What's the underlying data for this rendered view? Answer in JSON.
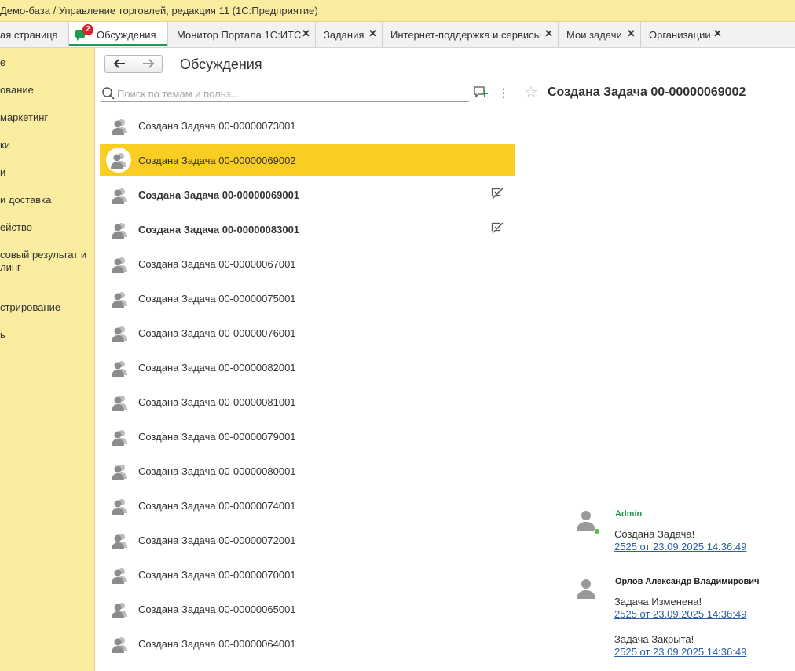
{
  "window": {
    "title": "Демо-база / Управление торговлей, редакция 11  (1С:Предприятие)"
  },
  "tabs": [
    {
      "label": "ая страница"
    },
    {
      "label": "Обсуждения",
      "badge": "2",
      "active": true
    },
    {
      "label": "Монитор Портала 1С:ИТС",
      "close": "✕"
    },
    {
      "label": "Задания",
      "close": "✕"
    },
    {
      "label": "Интернет-поддержка и сервисы",
      "close": "✕"
    },
    {
      "label": "Мои задачи",
      "close": "✕"
    },
    {
      "label": "Организации",
      "close": "✕"
    }
  ],
  "sidebar": {
    "items": [
      {
        "label": "е"
      },
      {
        "label": "ование"
      },
      {
        "label": "маркетинг"
      },
      {
        "label": "ки"
      },
      {
        "label": "и"
      },
      {
        "label": "и доставка"
      },
      {
        "label": "ейство"
      },
      {
        "label": "совый результат и",
        "label2": "линг"
      },
      {
        "label": "стрирование"
      },
      {
        "label": "ь"
      }
    ]
  },
  "header": {
    "title": "Обсуждения",
    "back_icon": "arrow-left-icon",
    "forward_icon": "arrow-right-icon"
  },
  "search": {
    "placeholder": "Поиск по темам и польз..."
  },
  "discussions": [
    {
      "label": "Создана Задача 00-00000073001"
    },
    {
      "label": "Создана Задача 00-00000069002",
      "selected": true
    },
    {
      "label": "Создана Задача 00-00000069001",
      "unread": true
    },
    {
      "label": "Создана Задача 00-00000083001",
      "unread": true
    },
    {
      "label": "Создана Задача 00-00000067001"
    },
    {
      "label": "Создана Задача 00-00000075001"
    },
    {
      "label": "Создана Задача 00-00000076001"
    },
    {
      "label": "Создана Задача 00-00000082001"
    },
    {
      "label": "Создана Задача 00-00000081001"
    },
    {
      "label": "Создана Задача 00-00000079001"
    },
    {
      "label": "Создана Задача 00-00000080001"
    },
    {
      "label": "Создана Задача 00-00000074001"
    },
    {
      "label": "Создана Задача 00-00000072001"
    },
    {
      "label": "Создана Задача 00-00000070001"
    },
    {
      "label": "Создана Задача 00-00000065001"
    },
    {
      "label": "Создана Задача 00-00000064001"
    }
  ],
  "detail": {
    "title": "Создана Задача 00-00000069002",
    "messages": [
      {
        "author": "Admin",
        "author_color": "#1e9b4e",
        "online": true,
        "entries": [
          {
            "text": "Создана Задача!",
            "link": "2525 от 23.09.2025 14:36:49"
          }
        ]
      },
      {
        "author": "Орлов Александр Владимирович",
        "author_color": "#222222",
        "online": false,
        "entries": [
          {
            "text": "Задача Изменена!",
            "link": "2525 от 23.09.2025 14:36:49"
          },
          {
            "text": "Задача Закрыта!",
            "link": "2525 от 23.09.2025 14:36:49"
          }
        ]
      }
    ]
  },
  "colors": {
    "sidebar_bg": "#fbeda0",
    "selection": "#f9cd22",
    "accent_green": "#1e9b4e",
    "badge_red": "#d9262c",
    "link_blue": "#2a5ea8"
  }
}
